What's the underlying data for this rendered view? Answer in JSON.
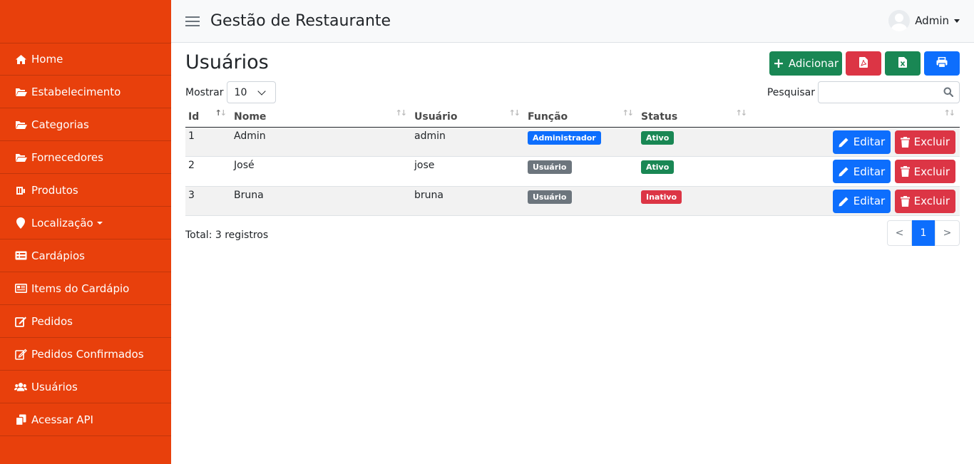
{
  "app": {
    "title": "Gestão de Restaurante"
  },
  "user": {
    "name": "Admin"
  },
  "sidebar": {
    "items": [
      {
        "label": "Home",
        "icon": "home-icon"
      },
      {
        "label": "Estabelecimento",
        "icon": "folder-open-icon"
      },
      {
        "label": "Categorias",
        "icon": "folder-open-icon"
      },
      {
        "label": "Fornecedores",
        "icon": "folder-open-icon"
      },
      {
        "label": "Produtos",
        "icon": "products-icon"
      },
      {
        "label": "Localização",
        "icon": "map-marker-icon"
      },
      {
        "label": "Cardápios",
        "icon": "list-icon"
      },
      {
        "label": "Items do Cardápio",
        "icon": "newspaper-icon"
      },
      {
        "label": "Pedidos",
        "icon": "edit-icon"
      },
      {
        "label": "Pedidos Confirmados",
        "icon": "edit-icon"
      },
      {
        "label": "Usuários",
        "icon": "users-icon"
      },
      {
        "label": "Acessar API",
        "icon": "copy-icon"
      }
    ],
    "bg_color": "#e8400c"
  },
  "page": {
    "title": "Usuários",
    "add_label": "Adicionar",
    "length_label": "Mostrar",
    "length_value": "10",
    "search_label": "Pesquisar",
    "search_value": ""
  },
  "table": {
    "columns": [
      "Id",
      "Nome",
      "Usuário",
      "Função",
      "Status"
    ],
    "rows": [
      {
        "id": "1",
        "nome": "Admin",
        "usuario": "admin",
        "funcao": "Administrador",
        "status": "Ativo"
      },
      {
        "id": "2",
        "nome": "José",
        "usuario": "jose",
        "funcao": "Usuário",
        "status": "Ativo"
      },
      {
        "id": "3",
        "nome": "Bruna",
        "usuario": "bruna",
        "funcao": "Usuário",
        "status": "Inativo"
      }
    ],
    "edit_label": "Editar",
    "delete_label": "Excluir"
  },
  "footer": {
    "total": "Total: 3 registros",
    "prev": "<",
    "page": "1",
    "next": ">"
  }
}
